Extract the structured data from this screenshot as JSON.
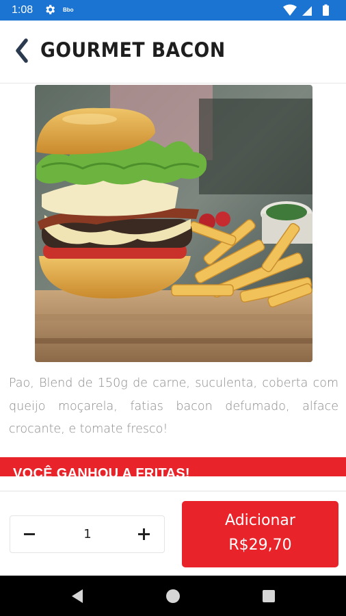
{
  "status_bar": {
    "time": "1:08",
    "mini_label": "Bbo",
    "background": "#1b74d1"
  },
  "header": {
    "title": "GOURMET BACON",
    "back_icon": "chevron-left-icon"
  },
  "product": {
    "image_alt": "burger-with-fries-photo",
    "description": "Pao, Blend de 150g de carne, suculenta, coberta com queijo moçarela, fatias bacon defumado, alface crocante, e tomate fresco!"
  },
  "promo": {
    "text": "VOCÊ GANHOU A FRITAS!",
    "color": "#e8242a"
  },
  "order": {
    "quantity": "1",
    "add_label": "Adicionar",
    "price": "R$29,70",
    "accent": "#e8242a"
  },
  "nav": {
    "back_icon": "triangle-back-icon",
    "home_icon": "circle-home-icon",
    "recents_icon": "square-recents-icon"
  }
}
